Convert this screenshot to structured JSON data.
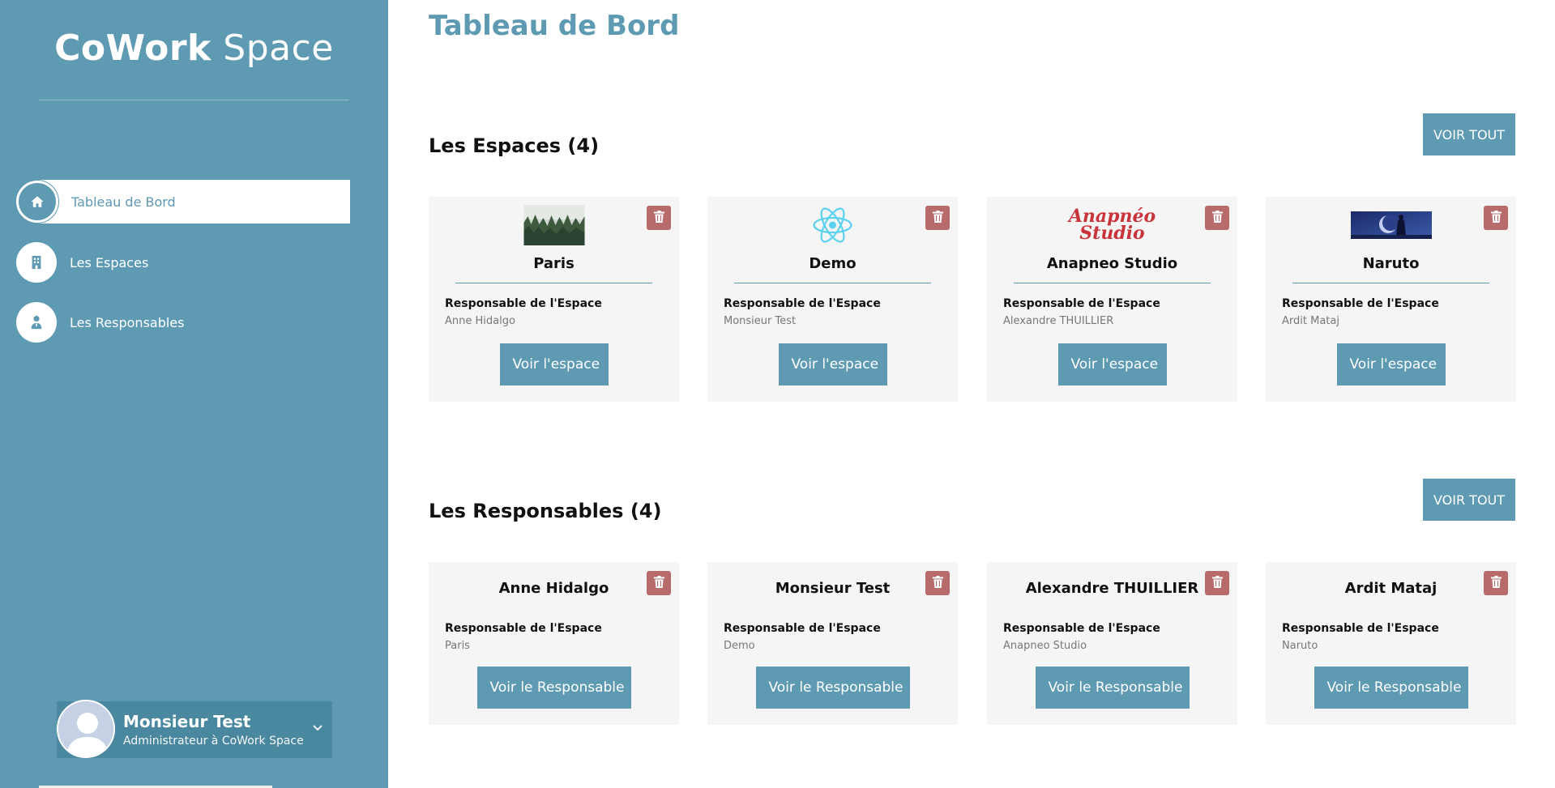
{
  "sidebar": {
    "brand_bold": "CoWork",
    "brand_light": "Space",
    "items": [
      {
        "label": "Tableau de Bord",
        "icon": "home-icon"
      },
      {
        "label": "Les Espaces",
        "icon": "building-icon"
      },
      {
        "label": "Les Responsables",
        "icon": "user-tie-icon"
      }
    ],
    "profile": {
      "name": "Monsieur Test",
      "role": "Administrateur à CoWork Space"
    }
  },
  "main": {
    "title": "Tableau de Bord",
    "espaces": {
      "title": "Les Espaces (4)",
      "voir_tout": "VOIR TOUT",
      "cards": [
        {
          "name": "Paris",
          "resp_label": "Responsable de l'Espace",
          "resp_value": "Anne Hidalgo",
          "button": "Voir l'espace"
        },
        {
          "name": "Demo",
          "resp_label": "Responsable de l'Espace",
          "resp_value": "Monsieur Test",
          "button": "Voir l'espace"
        },
        {
          "name": "Anapneo Studio",
          "resp_label": "Responsable de l'Espace",
          "resp_value": "Alexandre THUILLIER",
          "button": "Voir l'espace",
          "logo_text_1": "Anapnéo",
          "logo_text_2": "Studio"
        },
        {
          "name": "Naruto",
          "resp_label": "Responsable de l'Espace",
          "resp_value": "Ardit Mataj",
          "button": "Voir l'espace"
        }
      ]
    },
    "responsables": {
      "title": "Les Responsables (4)",
      "voir_tout": "VOIR TOUT",
      "cards": [
        {
          "name": "Anne Hidalgo",
          "resp_label": "Responsable de l'Espace",
          "resp_value": "Paris",
          "button": "Voir le Responsable"
        },
        {
          "name": "Monsieur Test",
          "resp_label": "Responsable de l'Espace",
          "resp_value": "Demo",
          "button": "Voir le Responsable"
        },
        {
          "name": "Alexandre THUILLIER",
          "resp_label": "Responsable de l'Espace",
          "resp_value": "Anapneo Studio",
          "button": "Voir le Responsable"
        },
        {
          "name": "Ardit Mataj",
          "resp_label": "Responsable de l'Espace",
          "resp_value": "Naruto",
          "button": "Voir le Responsable"
        }
      ]
    }
  },
  "colors": {
    "primary": "#5f9ab3",
    "danger": "#b86b6b",
    "card_bg": "#f5f5f5"
  }
}
